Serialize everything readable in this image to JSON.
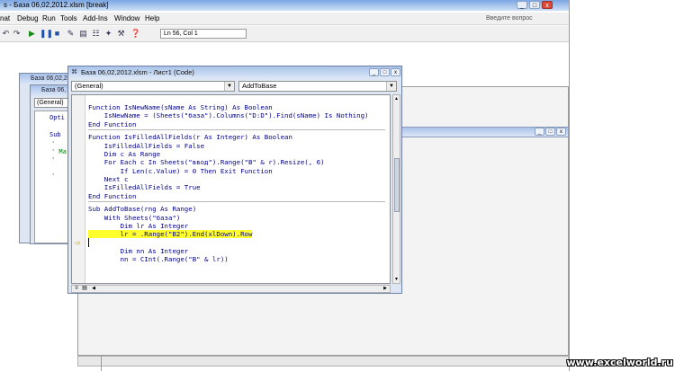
{
  "app": {
    "title": "s - База 06,02,2012.xlsm [break]",
    "window_buttons": [
      "_",
      "□",
      "x"
    ]
  },
  "menu": {
    "items": [
      "nat",
      "Debug",
      "Run",
      "Tools",
      "Add-Ins",
      "Window",
      "Help"
    ],
    "ask_placeholder": "Введите вопрос"
  },
  "toolbar": {
    "position_text": "Ln 56, Col 1"
  },
  "bg_windows": [
    {
      "title": "База 06,02,2"
    },
    {
      "title": "База 06,"
    }
  ],
  "bg_window_code": {
    "combo": "(General)",
    "lines": [
      "Opti",
      "Sub",
      "'",
      "' Ma",
      "'",
      "'"
    ]
  },
  "code_window": {
    "title": "База 06,02,2012.xlsm - Лист1 (Code)",
    "object_combo": "(General)",
    "proc_combo": "AddToBase",
    "buttons": [
      "_",
      "□",
      "x"
    ]
  },
  "code": [
    {
      "text": "Function IsNewName(sName As String) As Boolean",
      "type": "code"
    },
    {
      "text": "    IsNewName = (Sheets(\"база\").Columns(\"D:D\").Find(sName) Is Nothing)",
      "type": "code"
    },
    {
      "text": "End Function",
      "type": "code"
    },
    {
      "text": "",
      "type": "sep"
    },
    {
      "text": "Function IsFilledAllFields(r As Integer) As Boolean",
      "type": "code"
    },
    {
      "text": "    IsFilledAllFields = False",
      "type": "code"
    },
    {
      "text": "    Dim c As Range",
      "type": "code"
    },
    {
      "text": "    For Each c In Sheets(\"ввод\").Range(\"B\" & r).Resize(, 6)",
      "type": "code"
    },
    {
      "text": "        If Len(c.Value) = 0 Then Exit Function",
      "type": "code"
    },
    {
      "text": "    Next c",
      "type": "code"
    },
    {
      "text": "    IsFilledAllFields = True",
      "type": "code"
    },
    {
      "text": "End Function",
      "type": "code"
    },
    {
      "text": "",
      "type": "sep"
    },
    {
      "text": "Sub AddToBase(rng As Range)",
      "type": "code"
    },
    {
      "text": "    With Sheets(\"база\")",
      "type": "code"
    },
    {
      "text": "        Dim lr As Integer",
      "type": "code"
    },
    {
      "text": "        lr = .Range(\"B2\").End(xlDown).Row",
      "type": "highlight"
    },
    {
      "text": "",
      "type": "code"
    },
    {
      "text": "        Dim nn As Integer",
      "type": "code"
    },
    {
      "text": "        nn = CInt(.Range(\"B\" & lr))",
      "type": "code"
    }
  ],
  "watermark": "www.excelworld.ru",
  "colors": {
    "highlight": "#ffff2e",
    "code_text": "#00008b",
    "title_gradient_start": "#a9c3e8"
  }
}
